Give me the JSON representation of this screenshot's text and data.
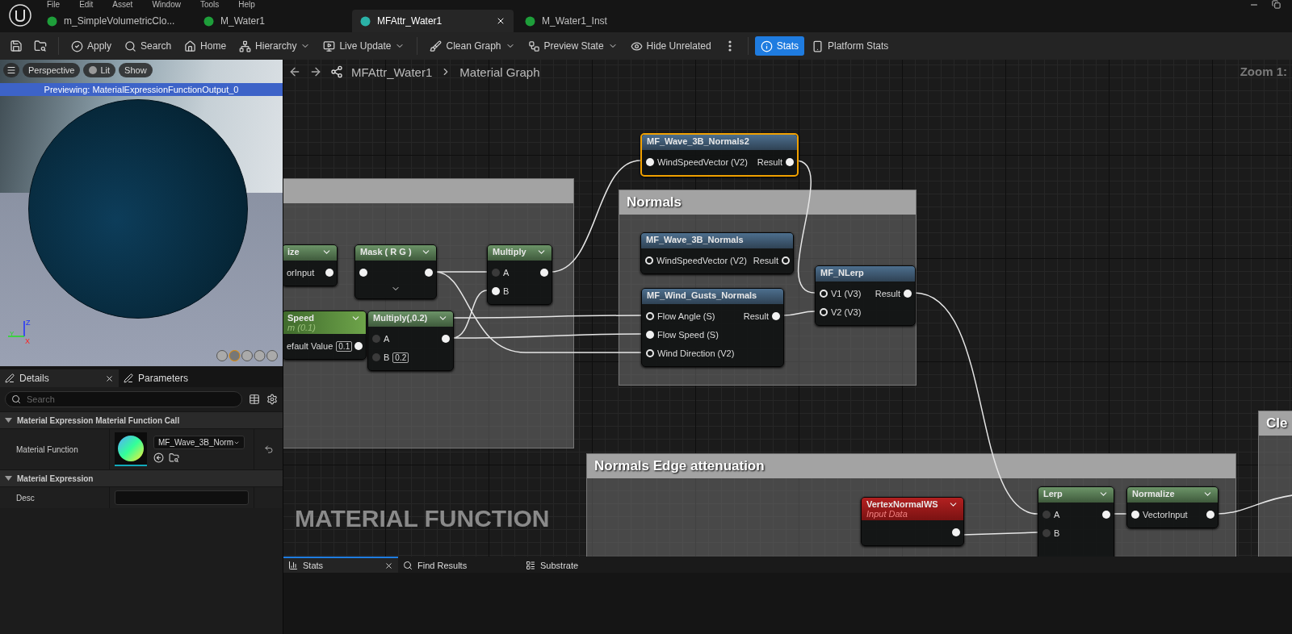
{
  "menu": [
    "File",
    "Edit",
    "Asset",
    "Window",
    "Tools",
    "Help"
  ],
  "tabs": [
    {
      "label": "m_SimpleVolumetricClo...",
      "selected": false,
      "color": "#1e9e3a"
    },
    {
      "label": "M_Water1",
      "selected": false,
      "color": "#1e9e3a"
    },
    {
      "label": "MFAttr_Water1",
      "selected": true,
      "color": "#2bb3a8"
    },
    {
      "label": "M_Water1_Inst",
      "selected": false,
      "color": "#1e9e3a"
    }
  ],
  "toolbar": [
    {
      "label": "Apply",
      "menu": false,
      "selected": false
    },
    {
      "label": "Search",
      "menu": false,
      "selected": false
    },
    {
      "label": "Home",
      "menu": false,
      "selected": false
    },
    {
      "label": "Hierarchy",
      "menu": true,
      "selected": false
    },
    {
      "label": "Live Update",
      "menu": true,
      "selected": false
    },
    {
      "label": "Clean Graph",
      "menu": true,
      "selected": false
    },
    {
      "label": "Preview State",
      "menu": true,
      "selected": false
    },
    {
      "label": "Hide Unrelated",
      "menu": false,
      "selected": false
    },
    {
      "label": "Stats",
      "menu": false,
      "selected": true
    },
    {
      "label": "Platform Stats",
      "menu": false,
      "selected": false
    }
  ],
  "viewport": {
    "buttons": [
      "Perspective",
      "Lit",
      "Show"
    ],
    "banner": "Previewing: MaterialExpressionFunctionOutput_0",
    "axis_labels": [
      "Z",
      "X",
      "Y"
    ]
  },
  "details": {
    "tabs": [
      {
        "label": "Details",
        "selected": true
      },
      {
        "label": "Parameters",
        "selected": false
      }
    ],
    "search": {
      "placeholder": "Search"
    },
    "sections": [
      {
        "title": "Material Expression Material Function Call",
        "rows": [
          {
            "label": "Material Function",
            "kind": "asset",
            "value": "MF_Wave_3B_Norm"
          }
        ]
      },
      {
        "title": "Material Expression",
        "rows": [
          {
            "label": "Desc",
            "kind": "text"
          }
        ]
      }
    ]
  },
  "graph": {
    "breadcrumb": [
      "MFAttr_Water1",
      "Material Graph"
    ],
    "zoom": "Zoom 1:",
    "watermark": "MATERIAL FUNCTION",
    "comments": [
      {
        "title": "Normals"
      },
      {
        "title": "Normals Edge attenuation"
      },
      {
        "title": "Cle"
      }
    ],
    "nodes": [
      {
        "title": "MF_Wave_3B_Normals2",
        "kind": "function",
        "selected": true,
        "rows": [
          {
            "left": "WindSpeedVector (V2)",
            "left_pin": {
              "connected": true
            },
            "right": "Result",
            "right_pin": {
              "connected": true
            }
          }
        ]
      },
      {
        "title": "ize",
        "kind": "math",
        "selected": false,
        "rows": [
          {
            "left": "orInput",
            "right_pin": {
              "connected": true
            }
          }
        ]
      },
      {
        "title": "Mask ( R G )",
        "kind": "math",
        "selected": false,
        "expander": true,
        "rows": [
          {
            "left_pin": {
              "connected": true
            },
            "right_pin": {
              "connected": true
            }
          }
        ]
      },
      {
        "title": "Multiply",
        "kind": "math",
        "selected": false,
        "rows": [
          {
            "left": "A",
            "left_pin": {
              "connected": false
            },
            "right_pin": {
              "connected": true
            }
          },
          {
            "left": "B",
            "left_pin": {
              "connected": true
            }
          }
        ]
      },
      {
        "title": "MF_Wave_3B_Normals",
        "kind": "function",
        "selected": false,
        "rows": [
          {
            "left": "WindSpeedVector (V2)",
            "left_pin": {
              "connected": false
            },
            "right": "Result",
            "right_pin": {
              "connected": false
            }
          }
        ]
      },
      {
        "title": "MF_NLerp",
        "kind": "function",
        "selected": false,
        "rows": [
          {
            "left": "V1 (V3)",
            "left_pin": {
              "connected": false
            },
            "right": "Result",
            "right_pin": {
              "connected": true
            }
          },
          {
            "left": "V2 (V3)",
            "left_pin": {
              "connected": false
            }
          }
        ]
      },
      {
        "title": "Speed",
        "subtitle": "m (0.1)",
        "kind": "parameter",
        "selected": false,
        "rows": [
          {
            "left": "efault Value",
            "value": "0.1",
            "right_pin": {
              "connected": true
            }
          }
        ]
      },
      {
        "title": "Multiply(,0.2)",
        "kind": "math",
        "selected": false,
        "rows": [
          {
            "left": "A",
            "left_pin": {
              "connected": false
            },
            "right_pin": {
              "connected": true
            }
          },
          {
            "left": "B",
            "left_pin": {
              "connected": false
            },
            "value": "0.2"
          }
        ]
      },
      {
        "title": "MF_Wind_Gusts_Normals",
        "kind": "function",
        "selected": false,
        "rows": [
          {
            "left": "Flow Angle (S)",
            "left_pin": {
              "connected": false
            },
            "right": "Result",
            "right_pin": {
              "connected": true
            }
          },
          {
            "left": "Flow Speed (S)",
            "left_pin": {
              "connected": true
            }
          },
          {
            "left": "Wind Direction (V2)",
            "left_pin": {
              "connected": false
            }
          }
        ]
      },
      {
        "title": "VertexNormalWS",
        "subtitle": "Input Data",
        "kind": "input",
        "selected": false,
        "rows": [
          {
            "right_pin": {
              "connected": true
            }
          }
        ]
      },
      {
        "title": "Lerp",
        "kind": "math",
        "selected": false,
        "rows": [
          {
            "left": "A",
            "left_pin": {
              "connected": false
            },
            "right_pin": {
              "connected": true
            }
          },
          {
            "left": "B",
            "left_pin": {
              "connected": false
            }
          }
        ]
      },
      {
        "title": "Normalize",
        "kind": "math",
        "selected": false,
        "rows": [
          {
            "left": "VectorInput",
            "left_pin": {
              "connected": true
            },
            "right_pin": {
              "connected": true
            }
          }
        ]
      }
    ]
  },
  "bottom_tabs": [
    {
      "label": "Stats",
      "selected": true
    },
    {
      "label": "Find Results",
      "selected": false
    },
    {
      "label": "Substrate",
      "selected": false
    }
  ]
}
